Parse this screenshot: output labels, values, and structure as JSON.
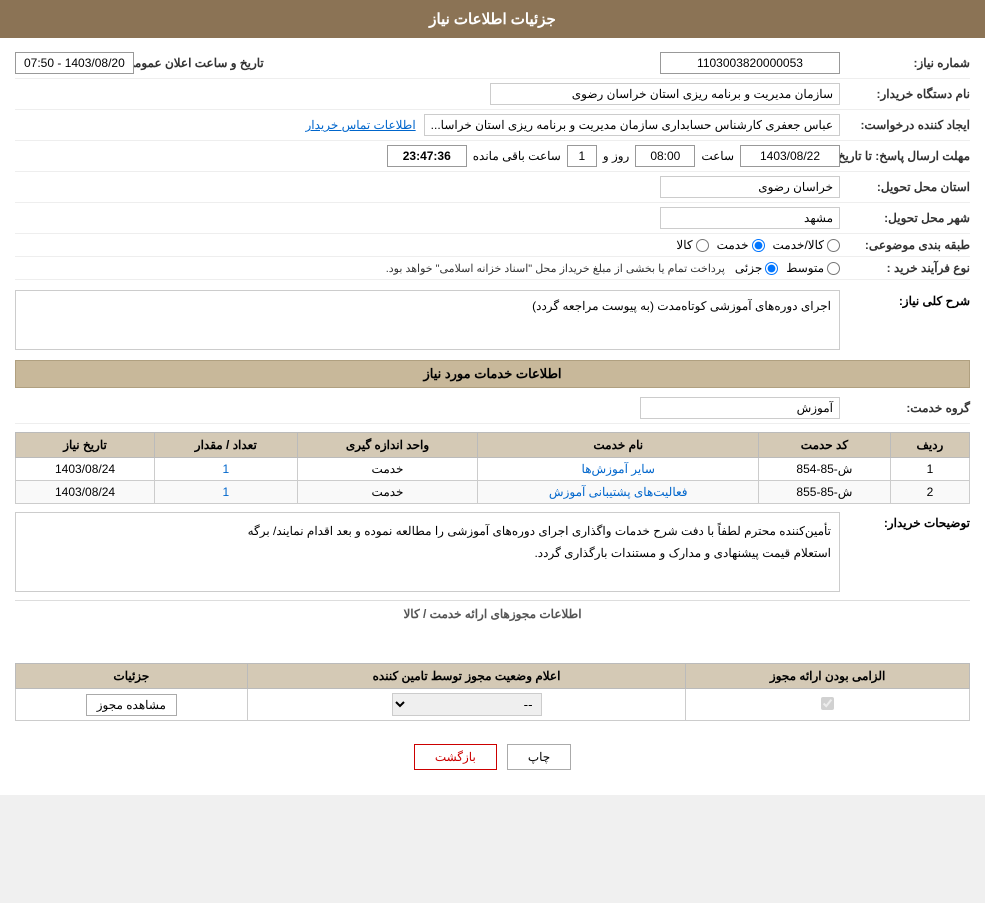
{
  "page": {
    "title": "جزئیات اطلاعات نیاز"
  },
  "header": {
    "شماره_نیاز_label": "شماره نیاز:",
    "شماره_نیاز_value": "1103003820000053",
    "تاریخ_label": "تاریخ و ساعت اعلان عمومی:",
    "تاریخ_value": "1403/08/20 - 07:50",
    "نام_دستگاه_label": "نام دستگاه خریدار:",
    "نام_دستگاه_value": "سازمان مدیریت و برنامه ریزی استان خراسان رضوی",
    "ایجاد_کننده_label": "ایجاد کننده درخواست:",
    "ایجاد_کننده_value": "عباس جعفری کارشناس حسابداری سازمان مدیریت و برنامه ریزی استان خراسا...",
    "اطلاعات_تماس": "اطلاعات تماس خریدار",
    "مهلت_ارسال_label": "مهلت ارسال پاسخ: تا تاریخ:",
    "تاریخ_مهلت": "1403/08/22",
    "ساعت_label": "ساعت",
    "ساعت_value": "08:00",
    "روز_label": "روز و",
    "روز_value": "1",
    "باقی_مانده_label": "ساعت باقی مانده",
    "ساعت_باقی": "23:47:36",
    "استان_تحویل_label": "استان محل تحویل:",
    "استان_تحویل_value": "خراسان رضوی",
    "شهر_تحویل_label": "شهر محل تحویل:",
    "شهر_تحویل_value": "مشهد",
    "طبقه_بندی_label": "طبقه بندی موضوعی:",
    "کالا_radio": "کالا",
    "خدمت_radio": "خدمت",
    "کالا_خدمت_radio": "کالا/خدمت",
    "نوع_فرآیند_label": "نوع فرآیند خرید :",
    "جزئی_radio": "جزئی",
    "متوسط_radio": "متوسط",
    "نوع_فرآیند_desc": "پرداخت تمام یا بخشی از مبلغ خریداز محل \"اسناد خزانه اسلامی\" خواهد بود."
  },
  "شرح_نیاز": {
    "section_title": "شرح کلی نیاز:",
    "description": "اجرای دوره‌های آموزشی کوتاه‌مدت (به پیوست مراجعه گردد)"
  },
  "اطلاعات_خدمات": {
    "section_title": "اطلاعات خدمات مورد نیاز",
    "گروه_حدمت_label": "گروه خدمت:",
    "گروه_حدمت_value": "آموزش",
    "table_headers": [
      "ردیف",
      "کد حدمت",
      "نام خدمت",
      "واحد اندازه گیری",
      "تعداد / مقدار",
      "تاریخ نیاز"
    ],
    "table_rows": [
      {
        "ردیف": "1",
        "کد_حدمت": "ش-85-854",
        "نام_خدمت": "سایر آموزش‌ها",
        "واحد": "خدمت",
        "تعداد": "1",
        "تاریخ": "1403/08/24"
      },
      {
        "ردیف": "2",
        "کد_حدمت": "ش-85-855",
        "نام_خدمت": "فعالیت‌های پشتیبانی آموزش",
        "واحد": "خدمت",
        "تعداد": "1",
        "تاریخ": "1403/08/24"
      }
    ]
  },
  "توضیحات_خریدار": {
    "label": "توضیحات خریدار:",
    "text_line1": "تأمین‌کننده محترم لطفاً با دفت شرح خدمات واگذاری اجرای دوره‌های آموزشی را مطالعه نموده و بعد اقدام نمایند/ برگه",
    "text_line2": "استعلام قیمت پیشنهادی و مدارک و مستندات بارگذاری گردد."
  },
  "اطلاعات_مجوز": {
    "section_title": "اطلاعات مجوزهای ارائه خدمت / کالا",
    "table_headers": [
      "الزامی بودن ارائه مجوز",
      "اعلام وضعیت مجوز توسط تامین کننده",
      "جزئیات"
    ],
    "table_rows": [
      {
        "الزامی": true,
        "وضعیت": "--",
        "جزئیات_btn": "مشاهده مجوز"
      }
    ]
  },
  "footer": {
    "print_btn": "چاپ",
    "back_btn": "بازگشت"
  }
}
